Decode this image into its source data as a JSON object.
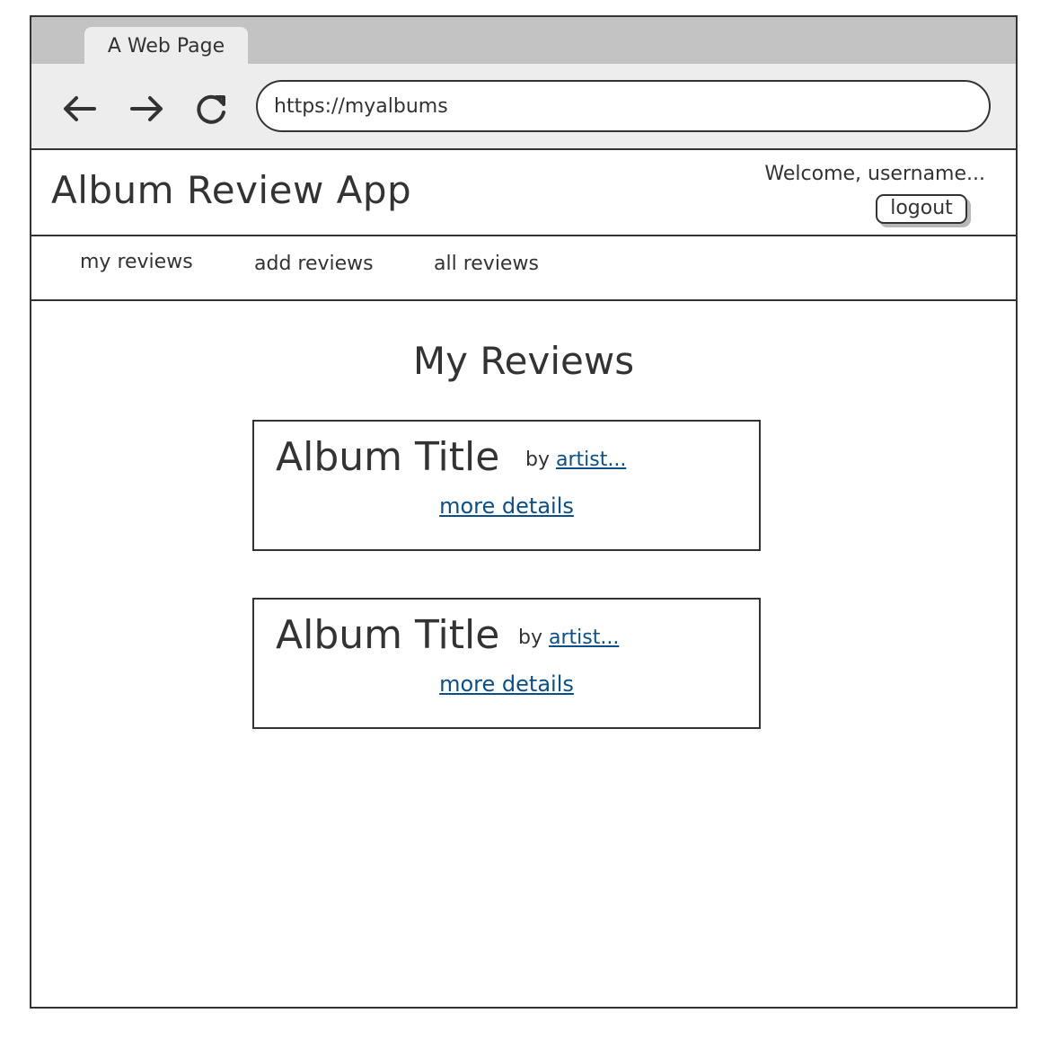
{
  "browser": {
    "tab_title": "A Web Page",
    "url": "https://myalbums"
  },
  "app": {
    "title": "Album Review App",
    "welcome_text": "Welcome, username...",
    "logout_label": "logout"
  },
  "nav": {
    "items": [
      {
        "label": "my reviews"
      },
      {
        "label": "add reviews"
      },
      {
        "label": "all reviews"
      }
    ]
  },
  "main": {
    "heading": "My Reviews",
    "reviews": [
      {
        "album_title": "Album Title",
        "by_label": "by",
        "artist": "artist...",
        "details_link": "more details"
      },
      {
        "album_title": "Album Title",
        "by_label": "by",
        "artist": "artist...",
        "details_link": "more details"
      }
    ]
  },
  "colors": {
    "link": "#0b4f8a",
    "text": "#333333",
    "chrome": "#ededed",
    "tabstrip": "#c3c3c3"
  },
  "icons": {
    "back": "arrow-left-icon",
    "forward": "arrow-right-icon",
    "reload": "reload-icon"
  }
}
